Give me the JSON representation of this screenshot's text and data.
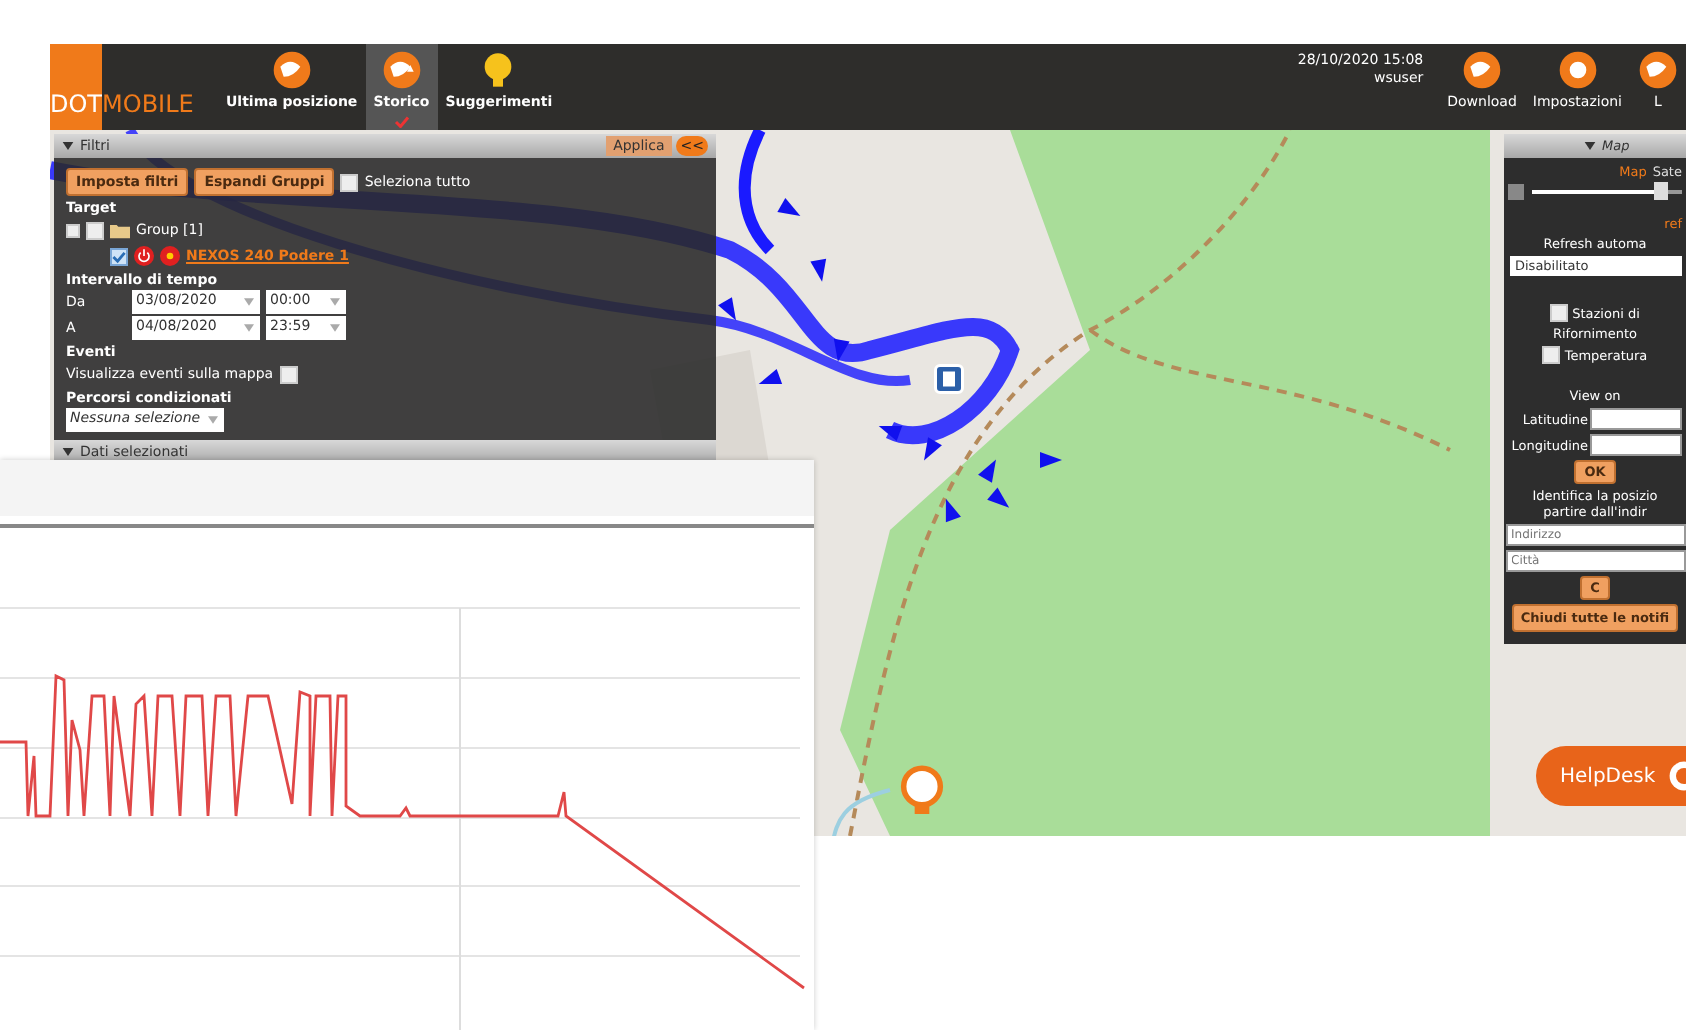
{
  "app_bar": {
    "logo": {
      "part_1": "DOT",
      "part_2": "MOBILE"
    },
    "nav": [
      {
        "label": "Ultima posizione",
        "selected": false
      },
      {
        "label": "Storico",
        "selected": true
      },
      {
        "label": "Suggerimenti",
        "selected": false
      }
    ],
    "datetime": "28/10/2020 15:08",
    "user": "wsuser",
    "actions": [
      {
        "label": "Download"
      },
      {
        "label": "Impostazioni"
      },
      {
        "label": "L"
      }
    ]
  },
  "filters_panel": {
    "title": "Filtri",
    "apply": "Applica",
    "collapse": "<<",
    "buttons": [
      "Imposta filtri",
      "Espandi Gruppi"
    ],
    "select_all": {
      "label": "Seleziona tutto",
      "checked": false
    },
    "target_label": "Target",
    "group": {
      "label": "Group [1]",
      "checked": false,
      "expanded": false
    },
    "vehicle": {
      "label": "NEXOS 240 Podere 1",
      "checked": true
    },
    "interval_label": "Intervallo di tempo",
    "from": {
      "label": "Da",
      "date": "03/08/2020",
      "time": "00:00"
    },
    "to": {
      "label": "A",
      "date": "04/08/2020",
      "time": "23:59"
    },
    "events_label": "Eventi",
    "show_events": {
      "label": "Visualizza eventi sulla mappa",
      "checked": false
    },
    "routes_label": "Percorsi condizionati",
    "routes_select": "Nessuna selezione",
    "next_section": "Dati selezionati"
  },
  "map_panel": {
    "title": "Map",
    "tabs": [
      {
        "label": "Map",
        "selected": true
      },
      {
        "label": "Sate",
        "selected": false
      }
    ],
    "zoom_slider": {
      "level": 0.85
    },
    "refresh_title": "ref",
    "refresh_label": "Refresh automa",
    "refresh_select": "Disabilitato",
    "layers": [
      {
        "label": "Stazioni di",
        "label_2": "Rifornimento",
        "checked": false
      },
      {
        "label": "Temperatura",
        "checked": false
      }
    ],
    "view_on": "View on",
    "latitude_label": "Latitudine",
    "longitude_label": "Longitudine",
    "ok": "OK",
    "identify_line_1": "Identifica la posizio",
    "identify_line_2": "partire dall'indir",
    "address_placeholder": "Indirizzo",
    "city_placeholder": "Città",
    "find": "C",
    "close_notifications": "Chiudi tutte le notifi"
  },
  "helpdesk": "HelpDesk"
}
